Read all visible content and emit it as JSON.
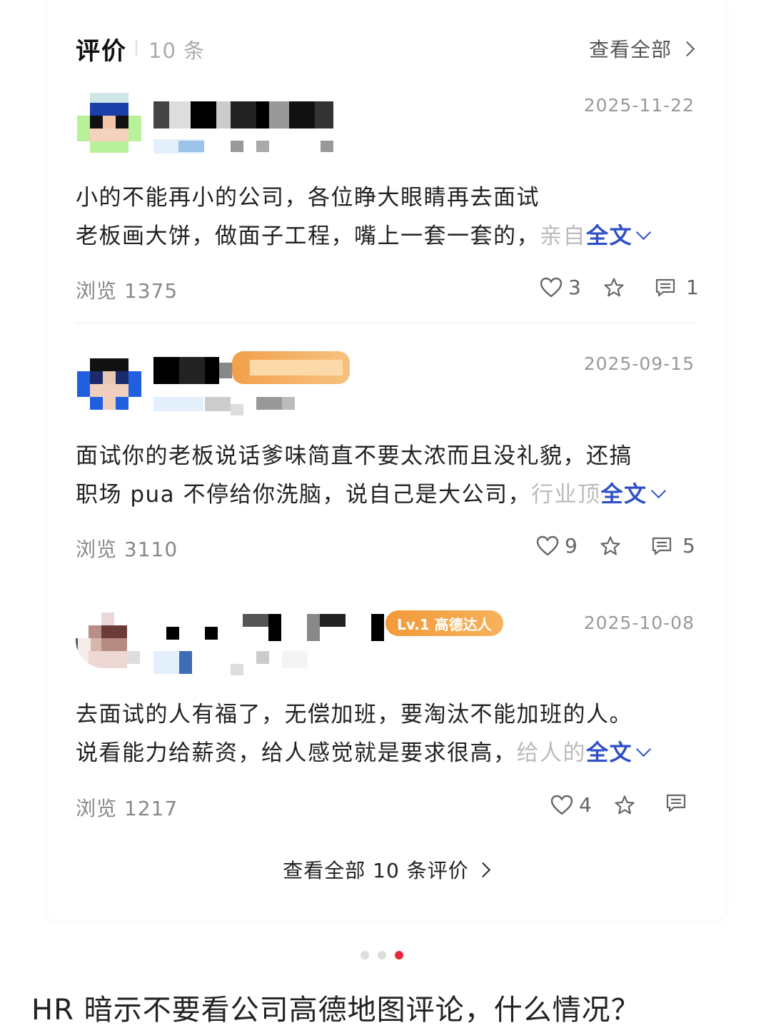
{
  "header": {
    "title": "评价",
    "count": "10 条",
    "view_all": "查看全部"
  },
  "reviews": [
    {
      "date": "2025-11-22",
      "line1": "小的不能再小的公司，各位睁大眼睛再去面试",
      "line2_main": "老板画大饼，做面子工程，嘴上一套一套的，",
      "line2_fade": "亲自",
      "fulltext": "全文",
      "views": "浏览 1375",
      "likes": "3",
      "comments": "1"
    },
    {
      "date": "2025-09-15",
      "line1": "面试你的老板说话爹味简直不要太浓而且没礼貌，还搞",
      "line2_main": "职场 pua 不停给你洗脑，说自己是大公司，",
      "line2_fade": "行业顶",
      "fulltext": "全文",
      "views": "浏览 3110",
      "likes": "9",
      "comments": "5"
    },
    {
      "date": "2025-10-08",
      "badge": "Lv.1 高德达人",
      "line1": "去面试的人有福了，无偿加班，要淘汰不能加班的人。",
      "line2_main": "说看能力给薪资，给人感觉就是要求很高，",
      "line2_fade": "给人的",
      "fulltext": "全文",
      "views": "浏览 1217",
      "likes": "4",
      "comments": ""
    }
  ],
  "footer": {
    "view_all_reviews": "查看全部 10 条评价"
  },
  "carousel": {
    "active_index": 2,
    "count": 3,
    "active_color": "#e8283c"
  },
  "caption": "HR 暗示不要看公司高德地图评论，什么情况？",
  "colors": {
    "fulltext": "#2f4fc6",
    "badge": "#f29a3a"
  }
}
